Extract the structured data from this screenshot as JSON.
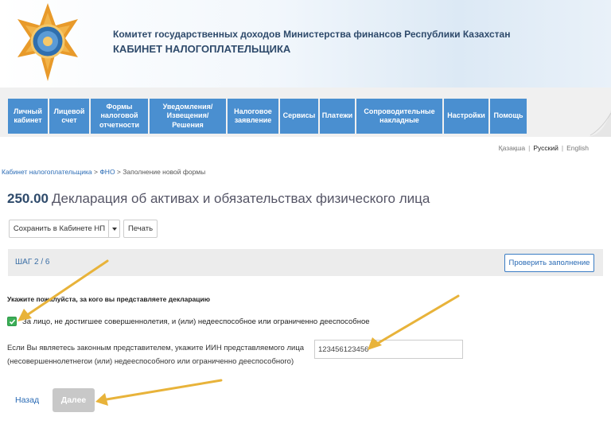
{
  "header": {
    "org_name": "Комитет государственных доходов Министерства финансов Республики Казахстан",
    "cabinet_name": "КАБИНЕТ НАЛОГОПЛАТЕЛЬЩИКА"
  },
  "nav": {
    "items": [
      {
        "label": "Личный\nкабинет"
      },
      {
        "label": "Лицевой\nсчет"
      },
      {
        "label": "Формы\nналоговой\nотчетности"
      },
      {
        "label": "Уведомления/\nИзвещения/\nРешения"
      },
      {
        "label": "Налоговое\nзаявление"
      },
      {
        "label": "Сервисы"
      },
      {
        "label": "Платежи"
      },
      {
        "label": "Сопроводительные\nнакладные"
      },
      {
        "label": "Настройки"
      },
      {
        "label": "Помощь"
      }
    ]
  },
  "languages": {
    "kazakh": "Қазақша",
    "russian": "Русский",
    "english": "English",
    "separator": "|"
  },
  "breadcrumb": {
    "home": "Кабинет налогоплательщика",
    "sep": " > ",
    "section": "ФНО",
    "current": "Заполнение новой формы"
  },
  "page": {
    "form_code": "250.00",
    "form_title": "Декларация об активах и обязательствах физического лица"
  },
  "toolbar": {
    "save_label": "Сохранить в Кабинете НП",
    "print_label": "Печать"
  },
  "step": {
    "label": "ШАГ 2 / 6",
    "check_button": "Проверить заполнение"
  },
  "form": {
    "question": "Укажите пожалуйста, за кого вы представляете декларацию",
    "checkbox_label": "За лицо, не достигшее совершеннолетия, и (или) недееспособное или ограниченно дееспособное",
    "checkbox_checked": true,
    "iin_label_line1": "Если Вы являетесь законным представителем, укажите ИИН представляемого лица",
    "iin_label_line2": "(несовершеннолетнегои (или) недееспособного или ограниченно дееспособного)",
    "iin_value": "123456123456"
  },
  "footer_nav": {
    "back_label": "Назад",
    "next_label": "Далее"
  },
  "colors": {
    "nav_blue": "#4a8fd0",
    "accent_link": "#2a6bb5",
    "checkbox_green": "#3cae57",
    "annotation_arrow": "#e8b33a"
  }
}
